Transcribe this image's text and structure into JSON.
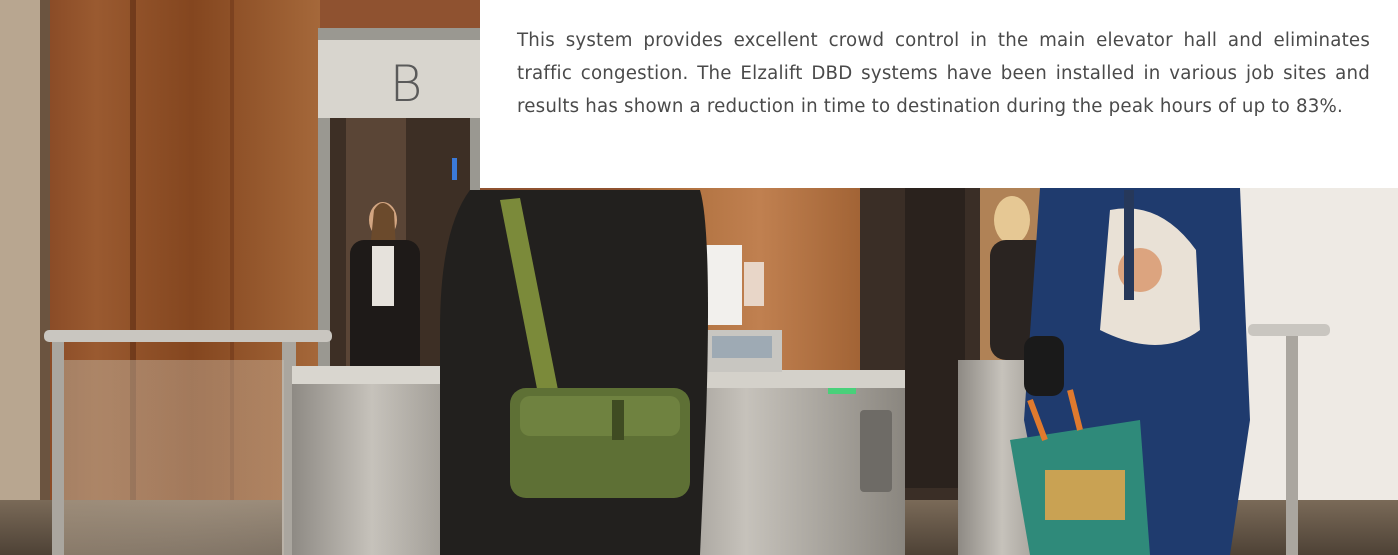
{
  "photo": {
    "sign_letter": "B",
    "caption": "This system provides excellent crowd control in the main elevator hall and eliminates traffic congestion. The Elzalift DBD systems have been installed in various job sites and results has shown a reduction in time to destination during the peak hours of up to 83%.",
    "description_colors": {
      "wood_panel": "#8a4a25",
      "steel": "#a9a6a0",
      "floor": "#6b5a48",
      "caption_bg": "#ffffff",
      "caption_text": "#4a4a4a"
    }
  }
}
